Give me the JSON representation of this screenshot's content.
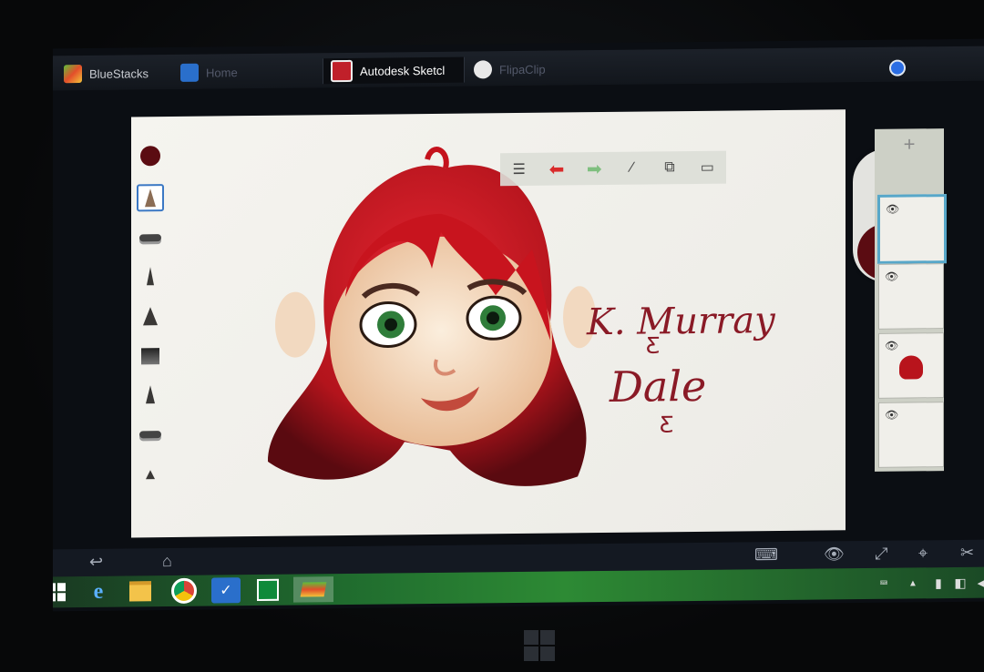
{
  "tabs": [
    {
      "label": "BlueStacks"
    },
    {
      "label": "Home"
    },
    {
      "label": "Autodesk Sketcl"
    },
    {
      "label": "FlipaClip"
    }
  ],
  "brush": {
    "size": "57",
    "color": "#5b0c12"
  },
  "signature": {
    "line1": "K. Murray",
    "line2": "Dale"
  },
  "layers": {
    "count": 4,
    "active_index": 0
  },
  "taskbar": {
    "apps": [
      "windows-start",
      "internet-explorer",
      "file-explorer",
      "chrome",
      "bluestacks-multi",
      "store",
      "bluestacks"
    ]
  },
  "colors": {
    "accent": "#3b78c4",
    "hair": "#c4121c",
    "selection": "#57a7c9"
  }
}
